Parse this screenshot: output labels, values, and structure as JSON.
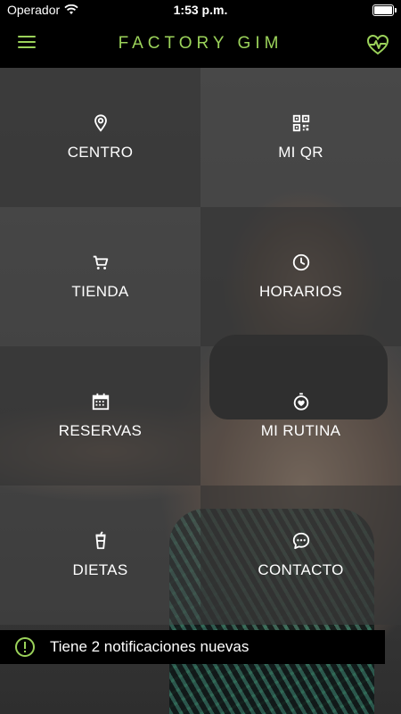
{
  "status_bar": {
    "carrier": "Operador",
    "time": "1:53 p.m."
  },
  "header": {
    "title": "FACTORY GIM",
    "menu_icon": "hamburger-menu-icon",
    "action_icon": "heart-pulse-icon"
  },
  "accent_color": "#9bd25a",
  "menu": {
    "items": [
      {
        "label": "CENTRO",
        "icon": "location-pin-icon"
      },
      {
        "label": "MI QR",
        "icon": "qr-code-icon"
      },
      {
        "label": "TIENDA",
        "icon": "shopping-cart-icon"
      },
      {
        "label": "HORARIOS",
        "icon": "clock-icon"
      },
      {
        "label": "RESERVAS",
        "icon": "calendar-icon"
      },
      {
        "label": "MI RUTINA",
        "icon": "stopwatch-heart-icon"
      },
      {
        "label": "DIETAS",
        "icon": "drink-cup-icon"
      },
      {
        "label": "CONTACTO",
        "icon": "chat-bubble-icon"
      }
    ]
  },
  "notification": {
    "text": "Tiene 2 notificaciones nuevas",
    "icon": "alert-circle-icon"
  }
}
